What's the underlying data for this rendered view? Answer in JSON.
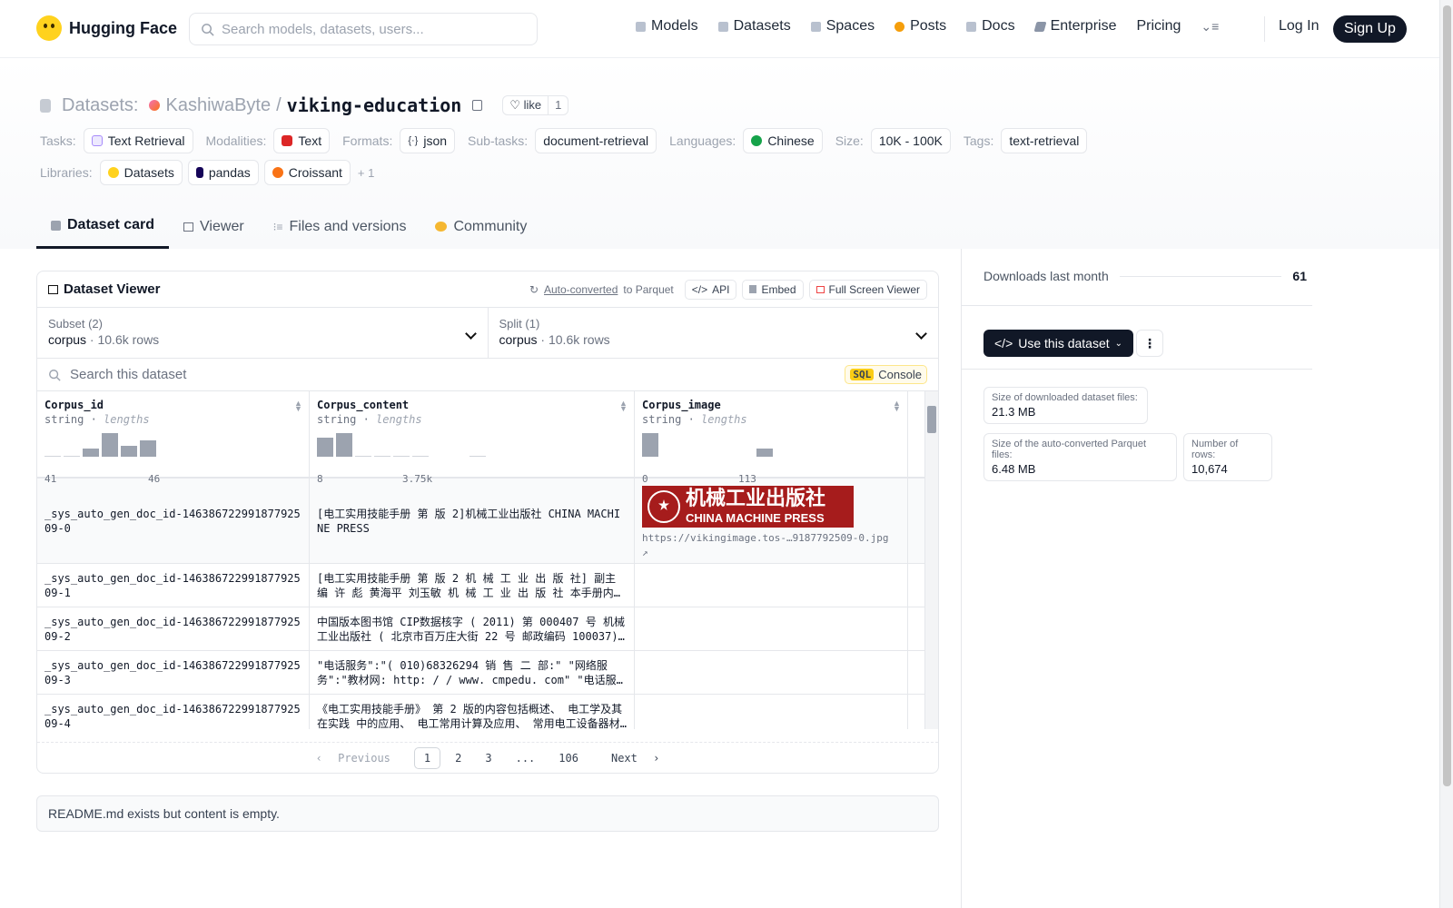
{
  "header": {
    "brand": "Hugging Face",
    "search_placeholder": "Search models, datasets, users...",
    "nav": [
      {
        "label": "Models",
        "color": "#b9c1cf"
      },
      {
        "label": "Datasets",
        "color": "#b9c1cf"
      },
      {
        "label": "Spaces",
        "color": "#b9c1cf"
      },
      {
        "label": "Posts",
        "color": "#f59e0b"
      },
      {
        "label": "Docs",
        "color": "#b9c1cf"
      },
      {
        "label": "Enterprise",
        "color": "#8b95a7"
      },
      {
        "label": "Pricing",
        "color": ""
      }
    ],
    "login": "Log In",
    "signup": "Sign Up"
  },
  "dataset": {
    "section": "Datasets:",
    "owner": "KashiwaByte",
    "name": "viking-education",
    "like_label": "like",
    "like_count": "1",
    "meta_row1": [
      {
        "label": "Tasks:",
        "value": "Text Retrieval",
        "icon_color": "#ede9fe"
      },
      {
        "label": "Modalities:",
        "value": "Text",
        "icon_color": "#dc2626"
      },
      {
        "label": "Formats:",
        "value": "json",
        "icon_color": ""
      },
      {
        "label": "Sub-tasks:",
        "value": "document-retrieval",
        "icon_color": ""
      },
      {
        "label": "Languages:",
        "value": "Chinese",
        "icon_color": "#16a34a"
      },
      {
        "label": "Size:",
        "value": "10K - 100K",
        "icon_color": ""
      },
      {
        "label": "Tags:",
        "value": "text-retrieval",
        "icon_color": ""
      }
    ],
    "libraries_label": "Libraries:",
    "libraries": [
      {
        "value": "Datasets",
        "icon_color": "#ffd21e"
      },
      {
        "value": "pandas",
        "icon_color": "#150458"
      },
      {
        "value": "Croissant",
        "icon_color": "#f97316"
      }
    ],
    "libraries_more": "+ 1"
  },
  "tabs": [
    "Dataset card",
    "Viewer",
    "Files and versions",
    "Community"
  ],
  "viewer": {
    "title": "Dataset Viewer",
    "auto_converted": "Auto-converted",
    "to_parquet": "to Parquet",
    "api": "API",
    "embed": "Embed",
    "fullscreen": "Full Screen Viewer",
    "subset_label": "Subset (2)",
    "subset_value": "corpus",
    "subset_rows": "10.6k rows",
    "split_label": "Split (1)",
    "split_value": "corpus",
    "split_rows": "10.6k rows",
    "search_placeholder": "Search this dataset",
    "sql": "SQL",
    "console": "Console",
    "columns": [
      {
        "name": "Corpus_id",
        "type": "string",
        "stat": "lengths",
        "min": "41",
        "max": "46",
        "hist": [
          0.05,
          0.05,
          0.35,
          1.0,
          0.45,
          0.7
        ]
      },
      {
        "name": "Corpus_content",
        "type": "string",
        "stat": "lengths",
        "min": "8",
        "max": "3.75k",
        "hist": [
          0.8,
          1.0,
          0.05,
          0.05,
          0.05,
          0.05,
          0.0,
          0.0,
          0.05
        ]
      },
      {
        "name": "Corpus_image",
        "type": "string",
        "stat": "lengths",
        "min": "0",
        "max": "113",
        "hist": [
          1.0,
          0.0,
          0.0,
          0.0,
          0.0,
          0.0,
          0.35
        ]
      }
    ],
    "rows": [
      {
        "id": "_sys_auto_gen_doc_id-14638672299187792509-0",
        "content": "[电工实用技能手册 第 版 2]机械工业出版社 CHINA MACHINE PRESS",
        "image_url": "https://vikingimage.tos-…9187792509-0.jpg ↗",
        "image_zh": "机械工业出版社",
        "image_en": "CHINA MACHINE PRESS"
      },
      {
        "id": "_sys_auto_gen_doc_id-14638672299187792509-1",
        "content": "[电工实用技能手册 第 版 2 机 械 工 业 出 版 社] 副主编 许 彪 黄海平 刘玉敏 机 械 工 业 出 版 社 本手册内容包括",
        "image_url": ""
      },
      {
        "id": "_sys_auto_gen_doc_id-14638672299187792509-2",
        "content": "中国版本图书馆 CIP数据核字 ( 2011) 第 000407 号 机械工业出版社 ( 北京市百万庄大街 22 号 邮政编码 100037)…",
        "image_url": ""
      },
      {
        "id": "_sys_auto_gen_doc_id-14638672299187792509-3",
        "content": "\"电话服务\":\"( 010)68326294 销 售 二 部:\" \"网络服务\":\"教材网: http: / / www. cmpedu. com\" \"电话服务…",
        "image_url": ""
      },
      {
        "id": "_sys_auto_gen_doc_id-14638672299187792509-4",
        "content": "《电工实用技能手册》 第 2 版的内容包括概述、 电工学及其在实践 中的应用、 电工常用计算及应用、 常用电工设备器材及…",
        "image_url": ""
      }
    ],
    "pager": {
      "prev": "Previous",
      "pages": [
        "1",
        "2",
        "3",
        "...",
        "106"
      ],
      "next": "Next"
    }
  },
  "readme": "README.md exists but content is empty.",
  "sidebar": {
    "downloads_label": "Downloads last month",
    "downloads_value": "61",
    "use_button": "Use this dataset",
    "stats": [
      {
        "k": "Size of downloaded dataset files:",
        "v": "21.3 MB"
      },
      {
        "k": "Size of the auto-converted Parquet files:",
        "v": "6.48 MB"
      },
      {
        "k": "Number of rows:",
        "v": "10,674"
      }
    ]
  }
}
